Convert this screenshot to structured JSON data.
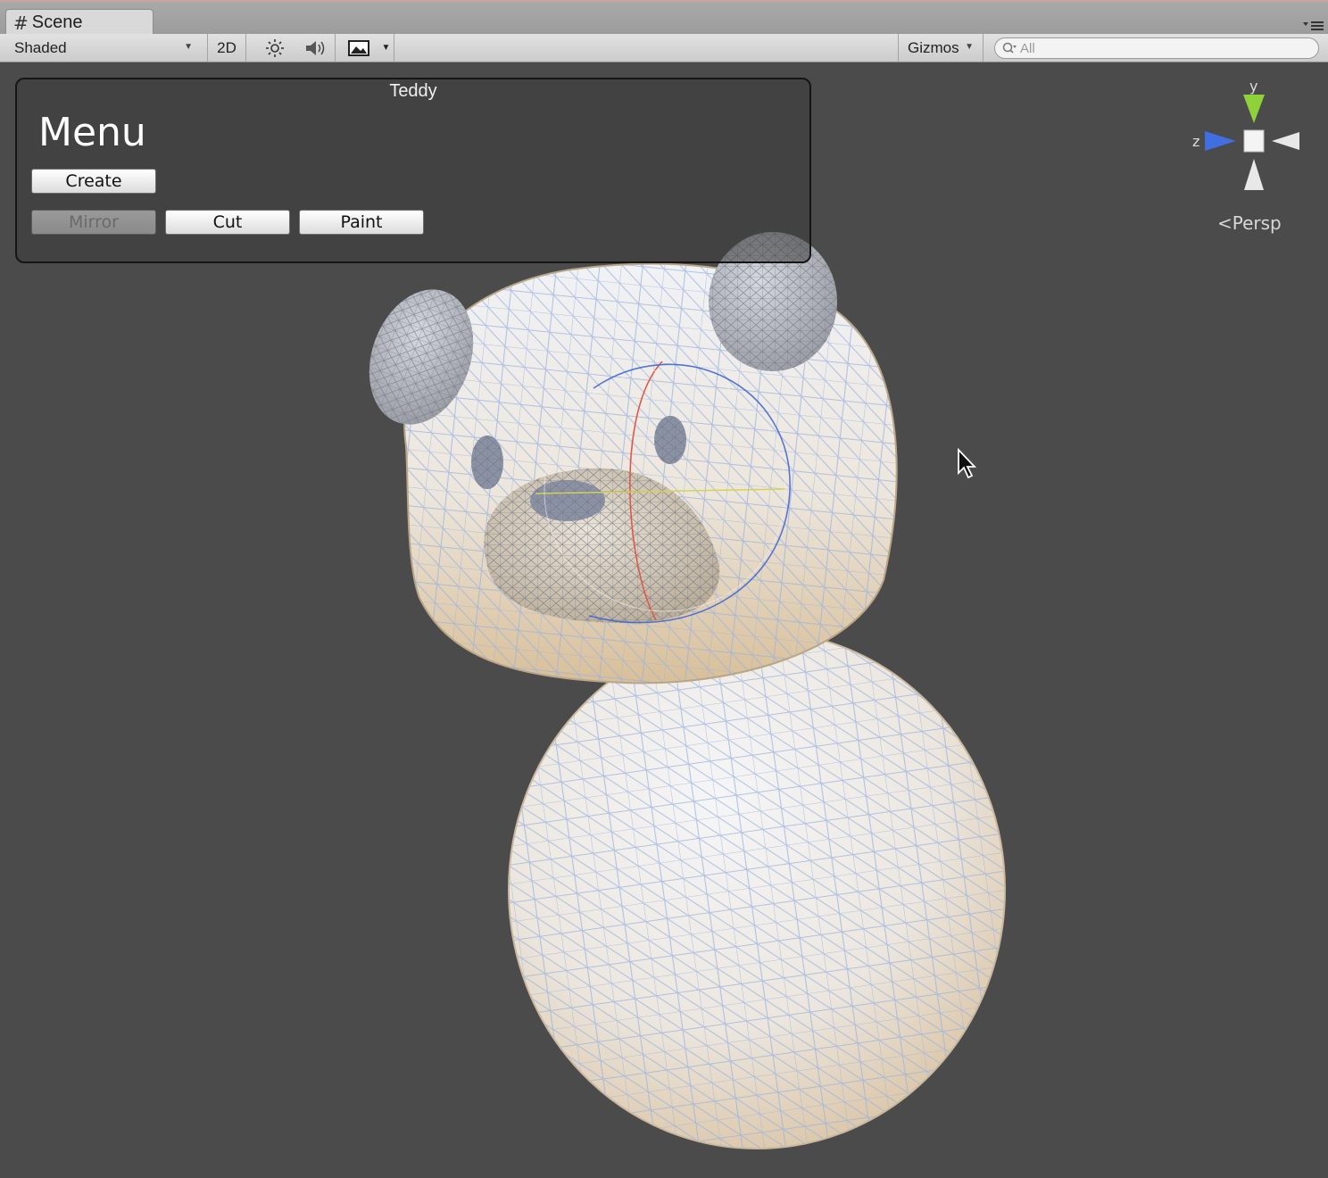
{
  "tab": {
    "label": "Scene"
  },
  "toolbar": {
    "shading_mode": "Shaded",
    "mode_2d_label": "2D",
    "gizmos_label": "Gizmos",
    "search_placeholder": "All"
  },
  "gui_window": {
    "title": "Teddy",
    "heading": "Menu",
    "buttons": {
      "create": "Create",
      "mirror": "Mirror",
      "cut": "Cut",
      "paint": "Paint"
    }
  },
  "gizmo": {
    "axis_y": "y",
    "axis_z": "z",
    "projection": "Persp"
  },
  "icons": {
    "tab": "grid-icon",
    "light": "sun-icon",
    "audio": "speaker-icon",
    "effects": "image-icon",
    "search": "search-icon",
    "panel_menu": "panel-menu-icon",
    "cursor": "mouse-cursor-icon"
  },
  "colors": {
    "viewport_bg": "#4b4b4b",
    "axis_y": "#8fd13a",
    "axis_z": "#3f6fe0",
    "mesh_wire": "#9bb3de"
  }
}
